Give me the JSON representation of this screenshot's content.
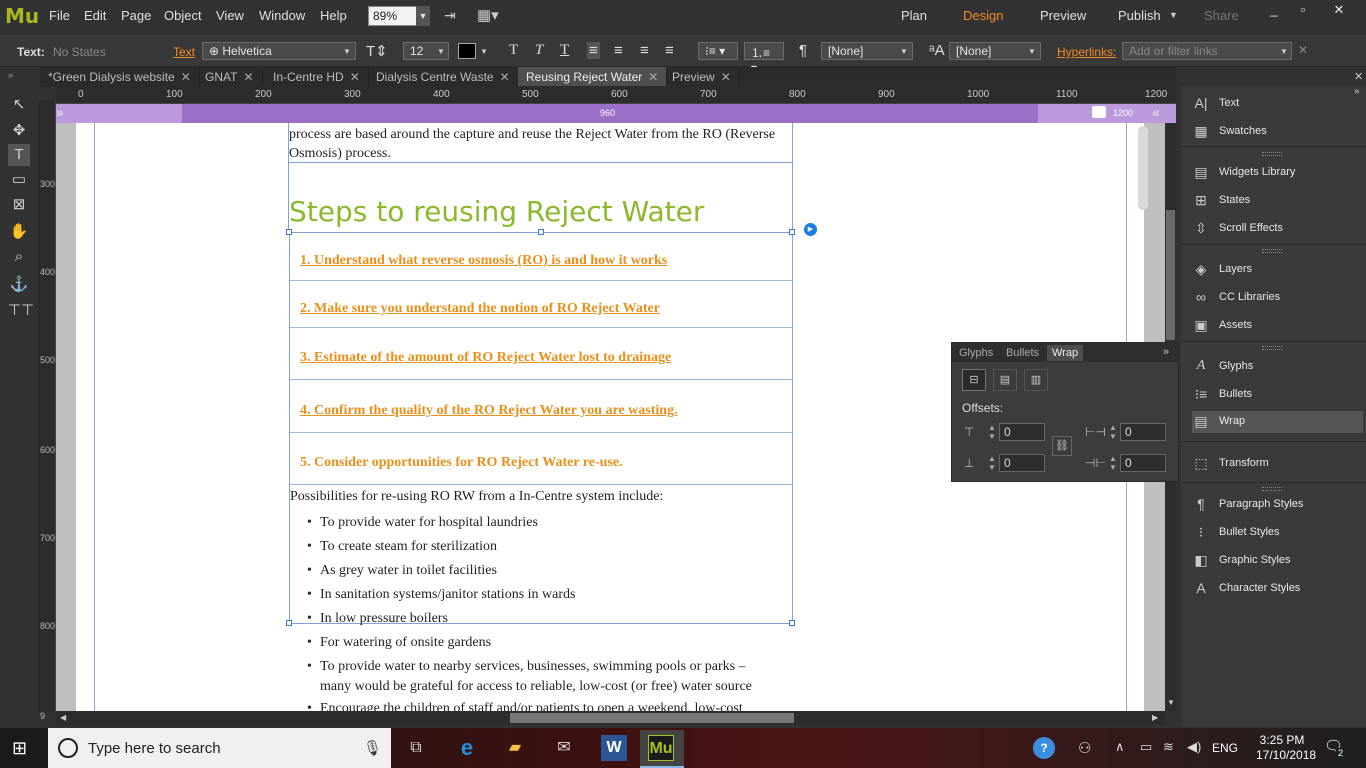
{
  "app": {
    "logo": "Mu",
    "menus": [
      "File",
      "Edit",
      "Page",
      "Object",
      "View",
      "Window",
      "Help"
    ],
    "zoom": "89%",
    "modes": [
      "Plan",
      "Design",
      "Preview",
      "Publish",
      "Share"
    ],
    "active_mode": "Design",
    "window_controls": [
      "_",
      "▫",
      "✕"
    ]
  },
  "control_bar": {
    "text_label": "Text:",
    "states": "No States",
    "text_link": "Text",
    "font": "Helvetica",
    "size": "12",
    "style_none1": "[None]",
    "style_none2": "[None]",
    "hyperlinks_label": "Hyperlinks:",
    "hyperlinks_placeholder": "Add or filter links"
  },
  "tabs": [
    {
      "label": "*Green Dialysis website"
    },
    {
      "label": "GNAT"
    },
    {
      "label": "In-Centre HD"
    },
    {
      "label": "Dialysis Centre Waste"
    },
    {
      "label": "Reusing Reject Water",
      "active": true
    },
    {
      "label": "Preview"
    }
  ],
  "ruler": {
    "h": [
      "0",
      "100",
      "200",
      "300",
      "400",
      "500",
      "600",
      "700",
      "800",
      "900",
      "1000",
      "1100",
      "1200"
    ],
    "v": [
      "300",
      "400",
      "500",
      "600",
      "700",
      "800",
      "9"
    ],
    "bp_width": "960",
    "bp_max": "1200"
  },
  "document": {
    "intro": "process are based around the capture and reuse the Reject Water from the RO (Reverse Osmosis) process.",
    "heading": "Steps to reusing Reject Water",
    "steps": [
      "1. Understand what reverse osmosis (RO) is and how it works",
      "2. Make sure you understand the notion of RO Reject Water",
      "3. Estimate of the amount of RO Reject Water lost to drainage",
      "4. Confirm the quality of the RO Reject Water you are wasting.",
      "5. Consider opportunities for RO Reject Water re-use."
    ],
    "para": "Possibilities for re-using RO RW from a In-Centre system include:",
    "bullets": [
      "To provide water for hospital laundries",
      "To create steam for sterilization",
      "As grey water in toilet facilities",
      "In sanitation systems/janitor stations in wards",
      "In low pressure boilers",
      "For watering of onsite gardens",
      "To provide water to nearby services, businesses, swimming pools or parks –",
      "many would be grateful for access to reliable, low-cost (or free) water source",
      "Encourage the children of staff and/or patients to open a weekend, low-cost"
    ]
  },
  "right_panel": {
    "items": [
      "Text",
      "Swatches",
      "Widgets Library",
      "States",
      "Scroll Effects",
      "Layers",
      "CC Libraries",
      "Assets",
      "Glyphs",
      "Bullets",
      "Wrap",
      "Transform",
      "Paragraph Styles",
      "Bullet Styles",
      "Graphic Styles",
      "Character Styles"
    ]
  },
  "wrap_panel": {
    "tabs": [
      "Glyphs",
      "Bullets",
      "Wrap"
    ],
    "offsets_label": "Offsets:",
    "top": "0",
    "left": "0",
    "bottom": "0",
    "right": "0"
  },
  "taskbar": {
    "search_placeholder": "Type here to search",
    "lang": "ENG",
    "time": "3:25 PM",
    "date": "17/10/2018",
    "notifications": "2"
  }
}
